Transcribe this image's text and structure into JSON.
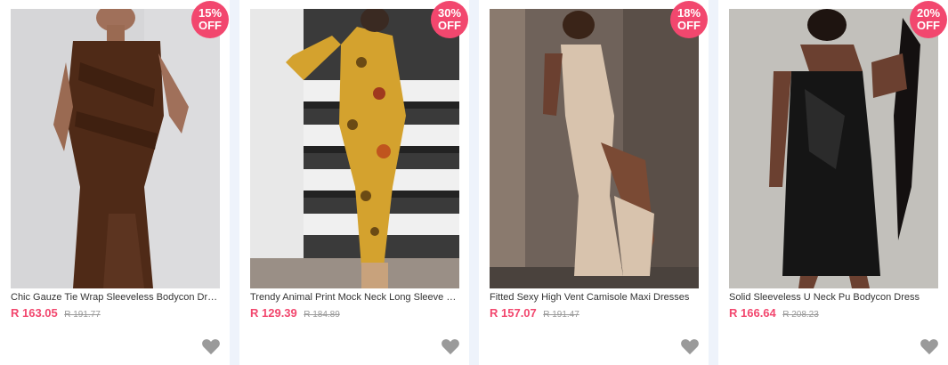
{
  "accent_color": "#f2476e",
  "products": [
    {
      "title": "Chic Gauze Tie Wrap Sleeveless Bodycon Dress",
      "price": "R 163.05",
      "old_price": "R 191.77",
      "discount": "15%",
      "discount_suffix": "OFF",
      "wishlist_icon": "heart-icon"
    },
    {
      "title": "Trendy Animal Print Mock Neck Long Sleeve D...",
      "price": "R 129.39",
      "old_price": "R 184.89",
      "discount": "30%",
      "discount_suffix": "OFF",
      "wishlist_icon": "heart-icon"
    },
    {
      "title": "Fitted Sexy High Vent Camisole Maxi Dresses",
      "price": "R 157.07",
      "old_price": "R 191.47",
      "discount": "18%",
      "discount_suffix": "OFF",
      "wishlist_icon": "heart-icon"
    },
    {
      "title": "Solid Sleeveless U Neck Pu Bodycon Dress",
      "price": "R 166.64",
      "old_price": "R 208.23",
      "discount": "20%",
      "discount_suffix": "OFF",
      "wishlist_icon": "heart-icon"
    }
  ]
}
